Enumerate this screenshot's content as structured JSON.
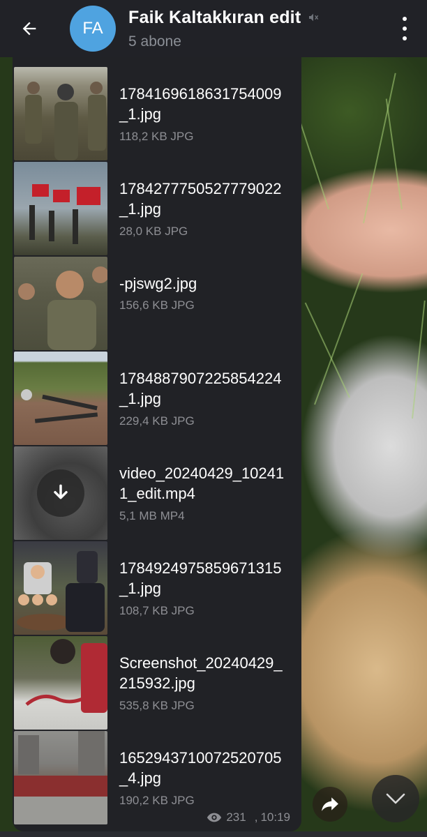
{
  "header": {
    "avatar_initials": "FA",
    "avatar_color": "#4fa3e0",
    "title": "Faik Kaltakkıran edit",
    "subtitle": "5 abone",
    "icons": [
      "back-arrow-icon",
      "mute-icon",
      "more-vert-icon"
    ]
  },
  "files": [
    {
      "name": "1784169618631754009_1.jpg",
      "meta": "118,2 KB JPG",
      "thumb": "photo-group-armed-men"
    },
    {
      "name": "1784277750527779022_1.jpg",
      "meta": "28,0 KB JPG",
      "thumb": "photo-flags-silhouettes"
    },
    {
      "name": "-pjswg2.jpg",
      "meta": "156,6 KB JPG",
      "thumb": "photo-laughing-man"
    },
    {
      "name": "1784887907225854224_1.jpg",
      "meta": "229,4 KB JPG",
      "thumb": "photo-field-weapons"
    },
    {
      "name": "video_20240429_102411_edit.mp4",
      "meta": "5,1 MB MP4",
      "thumb": "video-download"
    },
    {
      "name": "1784924975859671315_1.jpg",
      "meta": "108,7 KB JPG",
      "thumb": "photo-collage-grave"
    },
    {
      "name": "Screenshot_20240429_215932.jpg",
      "meta": "535,8 KB JPG",
      "thumb": "photo-hdp-wall"
    },
    {
      "name": "1652943710072520705_4.jpg",
      "meta": "190,2 KB JPG",
      "thumb": "photo-street-crowd"
    }
  ],
  "footer": {
    "views": "231",
    "time": "10:19",
    "separator": ","
  },
  "colors": {
    "header_bg": "#212227",
    "bubble_bg": "#212226",
    "meta_text": "#8e8f94"
  }
}
